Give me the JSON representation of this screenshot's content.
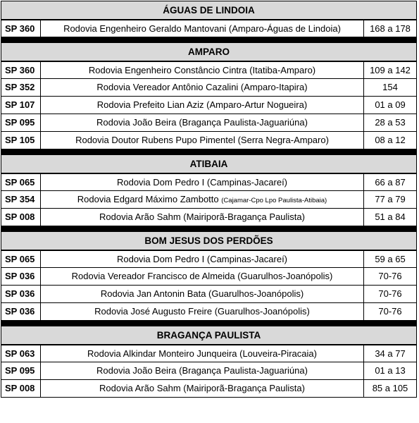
{
  "sections": [
    {
      "title": "ÁGUAS DE LINDOIA",
      "rows": [
        {
          "code": "SP 360",
          "name": "Rodovia Engenheiro Geraldo Mantovani (Amparo-Águas de Lindoia)",
          "km": "168 a 178"
        }
      ]
    },
    {
      "title": "AMPARO",
      "rows": [
        {
          "code": "SP 360",
          "name": "Rodovia Engenheiro Constâncio Cintra (Itatiba-Amparo)",
          "km": "109 a 142"
        },
        {
          "code": "SP 352",
          "name": "Rodovia Vereador Antônio Cazalini (Amparo-Itapira)",
          "km": "154"
        },
        {
          "code": "SP 107",
          "name": "Rodovia Prefeito Lian Aziz (Amparo-Artur Nogueira)",
          "km": "01 a 09"
        },
        {
          "code": "SP 095",
          "name": "Rodovia João Beira (Bragança Paulista-Jaguariúna)",
          "km": "28 a 53"
        },
        {
          "code": "SP 105",
          "name": "Rodovia Doutor Rubens Pupo Pimentel (Serra Negra-Amparo)",
          "km": "08 a 12"
        }
      ]
    },
    {
      "title": "ATIBAIA",
      "rows": [
        {
          "code": "SP 065",
          "name": "Rodovia Dom Pedro I (Campinas-Jacareí)",
          "km": "66 a 87"
        },
        {
          "code": "SP 354",
          "name": "Rodovia Edgard Máximo Zambotto",
          "name_small": "(Cajamar-Cpo Lpo Paulista-Atibaia)",
          "km": "77 a 79"
        },
        {
          "code": "SP 008",
          "name": "Rodovia Arão Sahm (Mairiporã-Bragança Paulista)",
          "km": "51 a 84"
        }
      ]
    },
    {
      "title": "BOM JESUS DOS PERDÕES",
      "rows": [
        {
          "code": "SP 065",
          "name": "Rodovia Dom Pedro I (Campinas-Jacareí)",
          "km": "59 a 65"
        },
        {
          "code": "SP 036",
          "name": "Rodovia Vereador Francisco de Almeida (Guarulhos-Joanópolis)",
          "km": "70-76"
        },
        {
          "code": "SP 036",
          "name": "Rodovia Jan Antonin Bata (Guarulhos-Joanópolis)",
          "km": "70-76"
        },
        {
          "code": "SP 036",
          "name": "Rodovia José Augusto Freire (Guarulhos-Joanópolis)",
          "km": "70-76"
        }
      ]
    },
    {
      "title": "BRAGANÇA PAULISTA",
      "rows": [
        {
          "code": "SP 063",
          "name": "Rodovia Alkindar Monteiro Junqueira (Louveira-Piracaia)",
          "km": "34 a 77"
        },
        {
          "code": "SP 095",
          "name": "Rodovia João Beira (Bragança Paulista-Jaguariúna)",
          "km": "01 a 13"
        },
        {
          "code": "SP 008",
          "name": "Rodovia Arão Sahm (Mairiporã-Bragança Paulista)",
          "km": "85 a 105"
        }
      ]
    }
  ]
}
